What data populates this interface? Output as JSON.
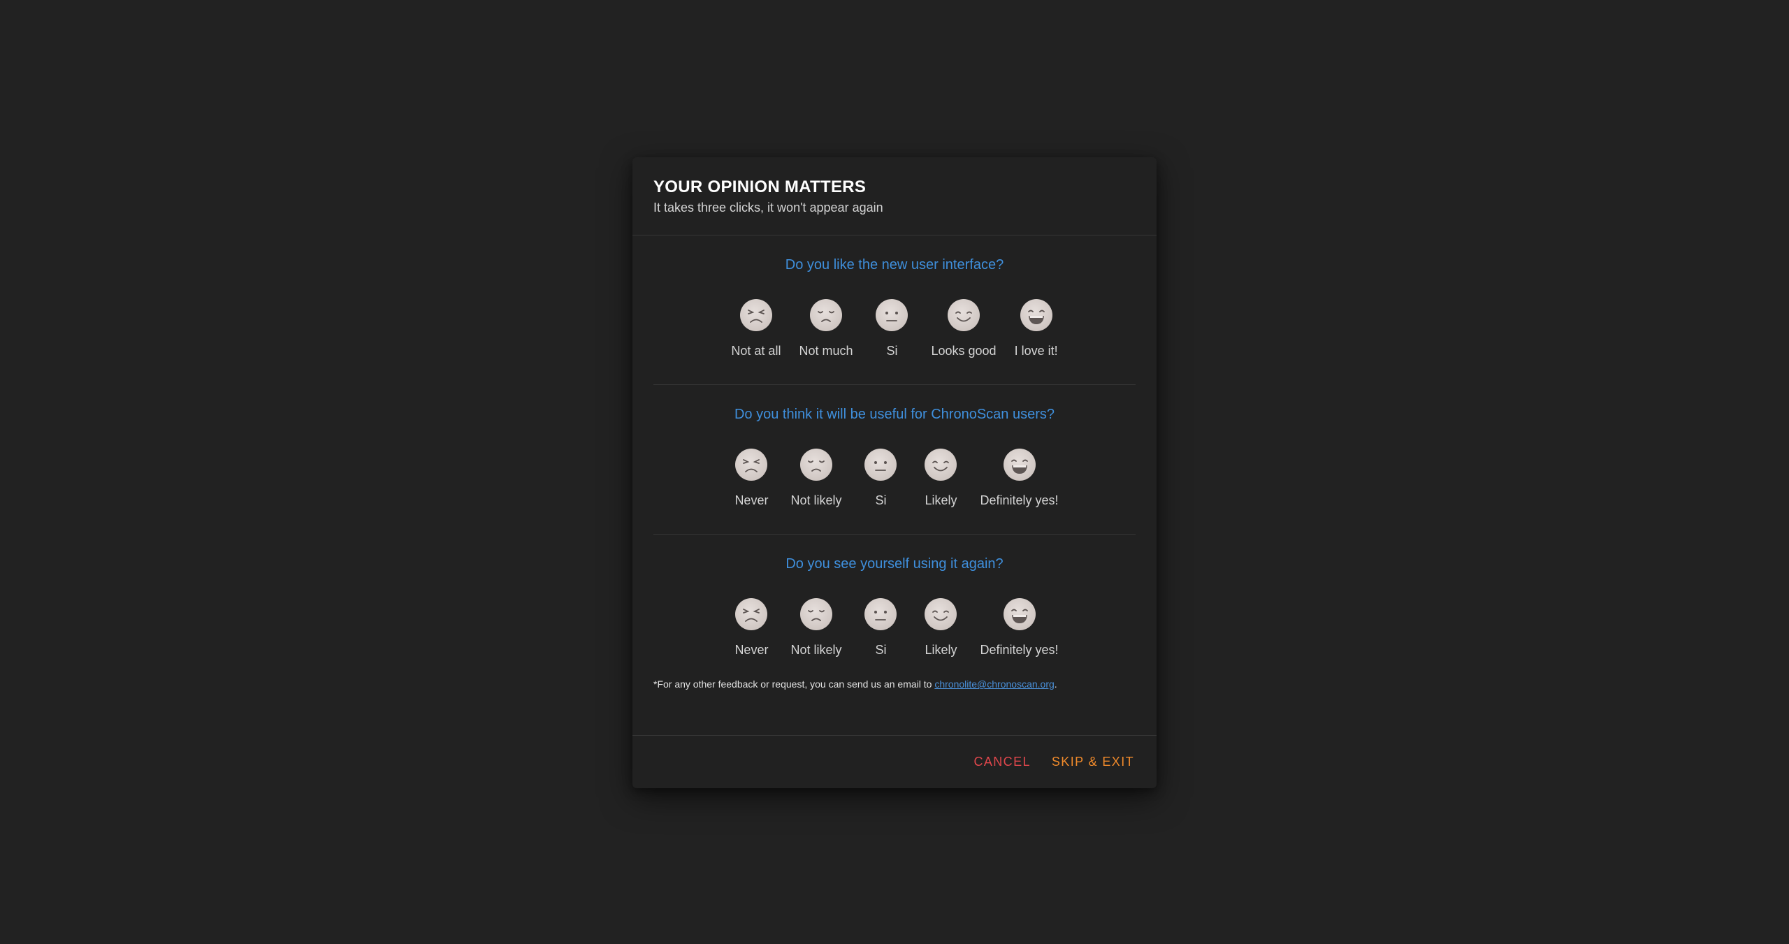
{
  "dialog": {
    "title": "YOUR OPINION MATTERS",
    "subtitle": "It takes three clicks, it won't appear again"
  },
  "questions": [
    {
      "text": "Do you like the new user interface?",
      "options": [
        "Not at all",
        "Not much",
        "Si",
        "Looks good",
        "I love it!"
      ]
    },
    {
      "text": "Do you think it will be useful for ChronoScan users?",
      "options": [
        "Never",
        "Not likely",
        "Si",
        "Likely",
        "Definitely yes!"
      ]
    },
    {
      "text": "Do you see yourself using it again?",
      "options": [
        "Never",
        "Not likely",
        "Si",
        "Likely",
        "Definitely yes!"
      ]
    }
  ],
  "face_icons": [
    "angry-face-icon",
    "sad-face-icon",
    "neutral-face-icon",
    "smiling-face-icon",
    "grinning-face-icon"
  ],
  "note": {
    "prefix": "*For any other feedback or request, you can send us an email to ",
    "email": "chronolite@chronoscan.org",
    "suffix": "."
  },
  "footer": {
    "cancel_label": "CANCEL",
    "skip_label": "SKIP & EXIT"
  },
  "colors": {
    "background": "#222222",
    "dialog": "#212121",
    "question": "#3f8fdc",
    "cancel": "#e0474c",
    "skip": "#f08a2b",
    "face": "#ddd5d2"
  }
}
